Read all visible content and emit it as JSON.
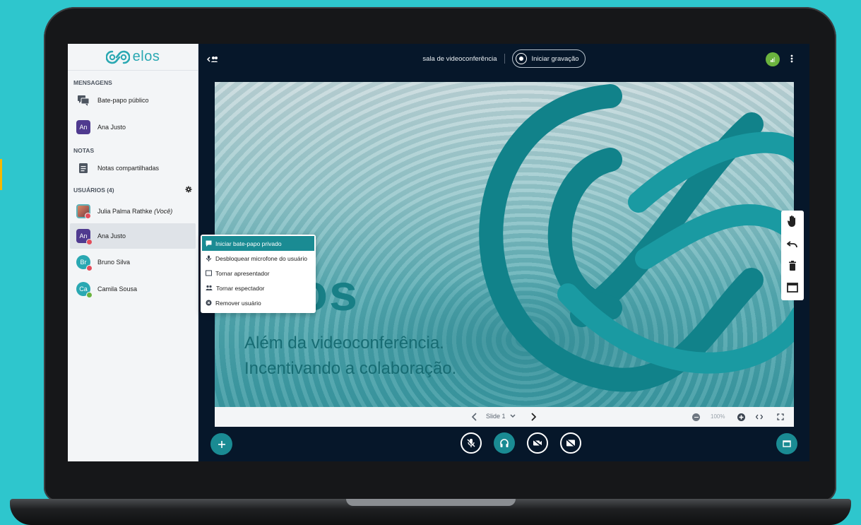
{
  "app": {
    "logo_text": "elos",
    "room_title": "sala de videoconferência",
    "record_label": "Iniciar gravação"
  },
  "sidebar": {
    "messages_title": "MENSAGENS",
    "public_chat": "Bate-papo público",
    "chat_user": {
      "initials": "An",
      "name": "Ana Justo"
    },
    "notes_title": "NOTAS",
    "shared_notes": "Notas compartilhadas",
    "users_title": "USUÁRIOS (4)",
    "users": [
      {
        "name": "Julia Palma Rathke",
        "suffix": "(Você)"
      },
      {
        "initials": "An",
        "name": "Ana Justo"
      },
      {
        "initials": "Br",
        "name": "Bruno Silva"
      },
      {
        "initials": "Ca",
        "name": "Camila Sousa"
      }
    ]
  },
  "context_menu": {
    "items": [
      "Iniciar bate-papo privado",
      "Desbloquear microfone do usuário",
      "Tornar apresentador",
      "Tornar espectador",
      "Remover usuário"
    ]
  },
  "slide": {
    "title": "elos",
    "line1": "Além da videoconferência.",
    "line2": "Incentivando a colaboração."
  },
  "slide_controls": {
    "slide_label": "Slide 1",
    "zoom": "100%"
  },
  "colors": {
    "accent": "#1a8b93",
    "background": "#2ec6cd",
    "screen": "#06172a"
  }
}
